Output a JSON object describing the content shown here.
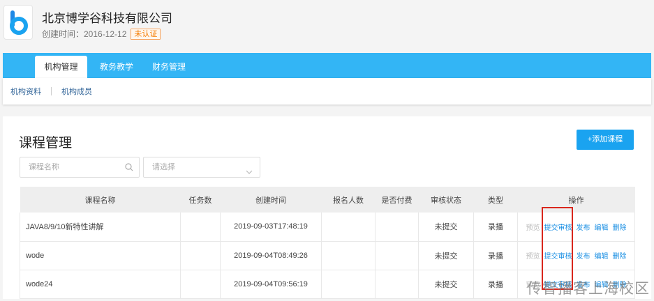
{
  "org": {
    "name": "北京博学谷科技有限公司",
    "created": "创建时间：2016-12-12",
    "badge": "未认证"
  },
  "topnav": {
    "tabs": [
      "机构管理",
      "教务教学",
      "财务管理"
    ],
    "active": 0
  },
  "subnav": {
    "items": [
      "机构资料",
      "机构成员"
    ]
  },
  "panel": {
    "title": "课程管理",
    "add_button": "+添加课程",
    "search_placeholder": "课程名称",
    "select_placeholder": "请选择"
  },
  "table": {
    "headers": [
      "课程名称",
      "任务数",
      "创建时间",
      "报名人数",
      "是否付费",
      "审核状态",
      "类型",
      "操作"
    ],
    "rows": [
      {
        "name": "JAVA8/9/10新特性讲解",
        "tasks": "",
        "created": "2019-09-03T17:48:19",
        "enrolled": "",
        "paid": "",
        "status": "未提交",
        "type": "录播"
      },
      {
        "name": "wode",
        "tasks": "",
        "created": "2019-09-04T08:49:26",
        "enrolled": "",
        "paid": "",
        "status": "未提交",
        "type": "录播"
      },
      {
        "name": "wode24",
        "tasks": "",
        "created": "2019-09-04T09:56:19",
        "enrolled": "",
        "paid": "",
        "status": "未提交",
        "type": "录播"
      }
    ],
    "ops": [
      "预览",
      "提交审核",
      "发布",
      "编辑",
      "删除"
    ]
  },
  "watermark": "传智播客上海校区",
  "colors": {
    "primary": "#33b5f5",
    "button": "#1aa3f0",
    "link": "#1a8fe3",
    "highlight": "#d9261c"
  }
}
